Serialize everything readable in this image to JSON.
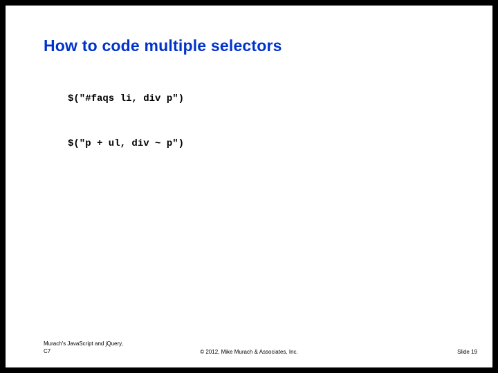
{
  "heading": "How to code multiple selectors",
  "code": {
    "line1": "$(\"#faqs li, div p\")",
    "line2": "$(\"p + ul, div ~ p\")"
  },
  "footer": {
    "left_line1": "Murach's JavaScript and jQuery,",
    "left_line2": "C7",
    "center": "© 2012, Mike Murach & Associates, Inc.",
    "right": "Slide 19"
  }
}
